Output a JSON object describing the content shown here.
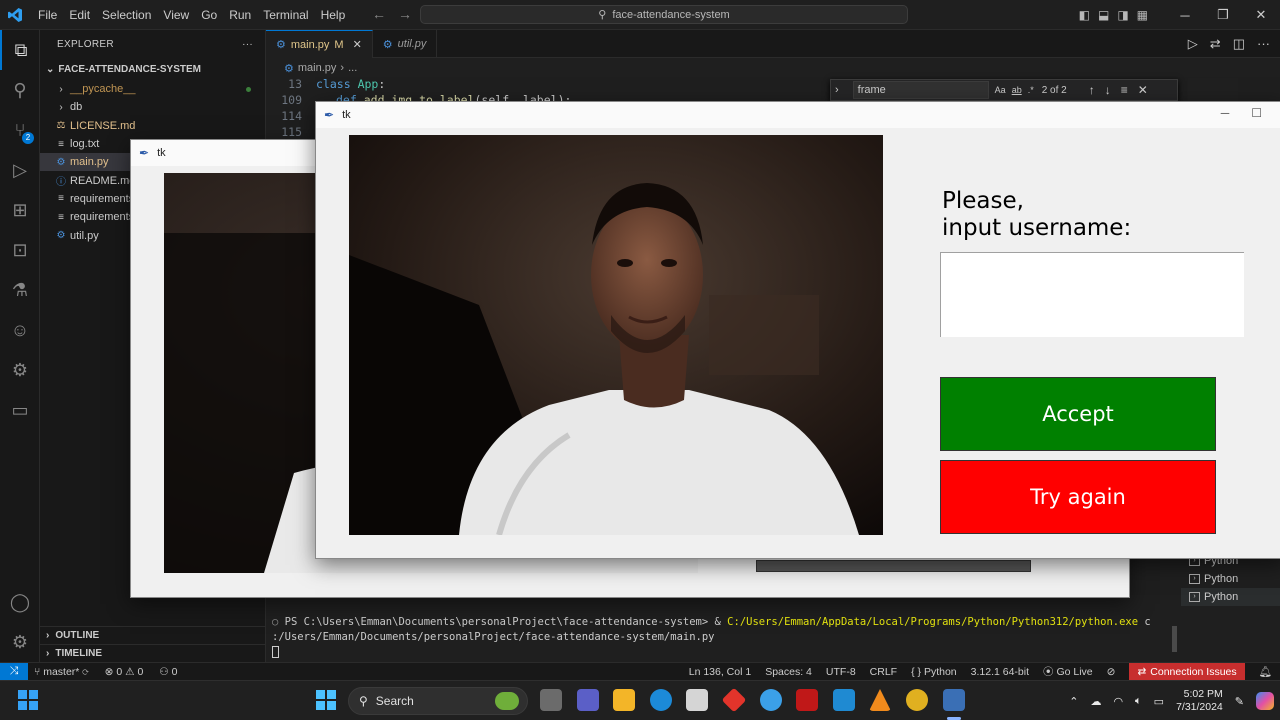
{
  "titlebar": {
    "menu": [
      "File",
      "Edit",
      "Selection",
      "View",
      "Go",
      "Run",
      "Terminal",
      "Help"
    ],
    "search_text": "face-attendance-system"
  },
  "explorer": {
    "header": "EXPLORER",
    "more": "···",
    "project": "FACE-ATTENDANCE-SYSTEM",
    "items": [
      {
        "label": "__pycache__",
        "icon": "chevron-right",
        "color": "#c09553"
      },
      {
        "label": "db",
        "icon": "chevron-right",
        "color": "#cccccc"
      },
      {
        "label": "LICENSE.md",
        "icon": "license-icon",
        "color": "#e2c08d"
      },
      {
        "label": "log.txt",
        "icon": "text-icon",
        "color": "#cccccc"
      },
      {
        "label": "main.py",
        "icon": "python-icon",
        "color": "#e2c08d"
      },
      {
        "label": "README.md",
        "icon": "info-icon",
        "color": "#cccccc"
      },
      {
        "label": "requirements",
        "icon": "text-icon",
        "color": "#cccccc"
      },
      {
        "label": "requirements",
        "icon": "text-icon",
        "color": "#cccccc"
      },
      {
        "label": "util.py",
        "icon": "python-icon",
        "color": "#cccccc"
      }
    ],
    "outline": "OUTLINE",
    "timeline": "TIMELINE"
  },
  "activity_badge": "2",
  "tabs": [
    {
      "label": "main.py",
      "modified": "M",
      "close": "✕"
    },
    {
      "label": "util.py"
    }
  ],
  "breadcrumb": {
    "file": "main.py",
    "rest": "..."
  },
  "code": [
    {
      "ln": "13",
      "kw": "class",
      "name": "App",
      "tail": ":"
    },
    {
      "ln": "109",
      "kw": "def",
      "name": "add_img_to_label",
      "tail": "(self, label):"
    },
    {
      "ln": "114",
      "kw": "",
      "name": "",
      "tail": ""
    },
    {
      "ln": "115",
      "kw": "",
      "name": "",
      "tail": ""
    }
  ],
  "find": {
    "query": "frame",
    "opts": [
      "Aa",
      "ab",
      ".*"
    ],
    "count": "2 of 2"
  },
  "terminal": {
    "prompt": "PS C:\\Users\\Emman\\Documents\\personalProject\\face-attendance-system> & ",
    "command": "C:/Users/Emman/AppData/Local/Programs/Python/Python312/python.exe",
    "command_tail": " c",
    "line2": ":/Users/Emman/Documents/personalProject/face-attendance-system/main.py"
  },
  "terminal_list": [
    "Python",
    "Python",
    "Python"
  ],
  "statusbar": {
    "branch": "master*",
    "errors": "0",
    "warnings": "0",
    "ports": "0",
    "position": "Ln 136, Col 1",
    "spaces": "Spaces: 4",
    "encoding": "UTF-8",
    "eol": "CRLF",
    "language": "Python",
    "interpreter": "3.12.1 64-bit",
    "golive": "Go Live",
    "connection": "Connection Issues"
  },
  "tk_back": {
    "title": "tk"
  },
  "tk_front": {
    "title": "tk",
    "prompt": "Please,\ninput username:",
    "accept_label": "Accept",
    "accept_color": "#008000",
    "try_again_label": "Try again",
    "try_again_color": "#ff0000"
  },
  "taskbar": {
    "search_label": "Search",
    "time": "5:02 PM",
    "date": "7/31/2024"
  }
}
